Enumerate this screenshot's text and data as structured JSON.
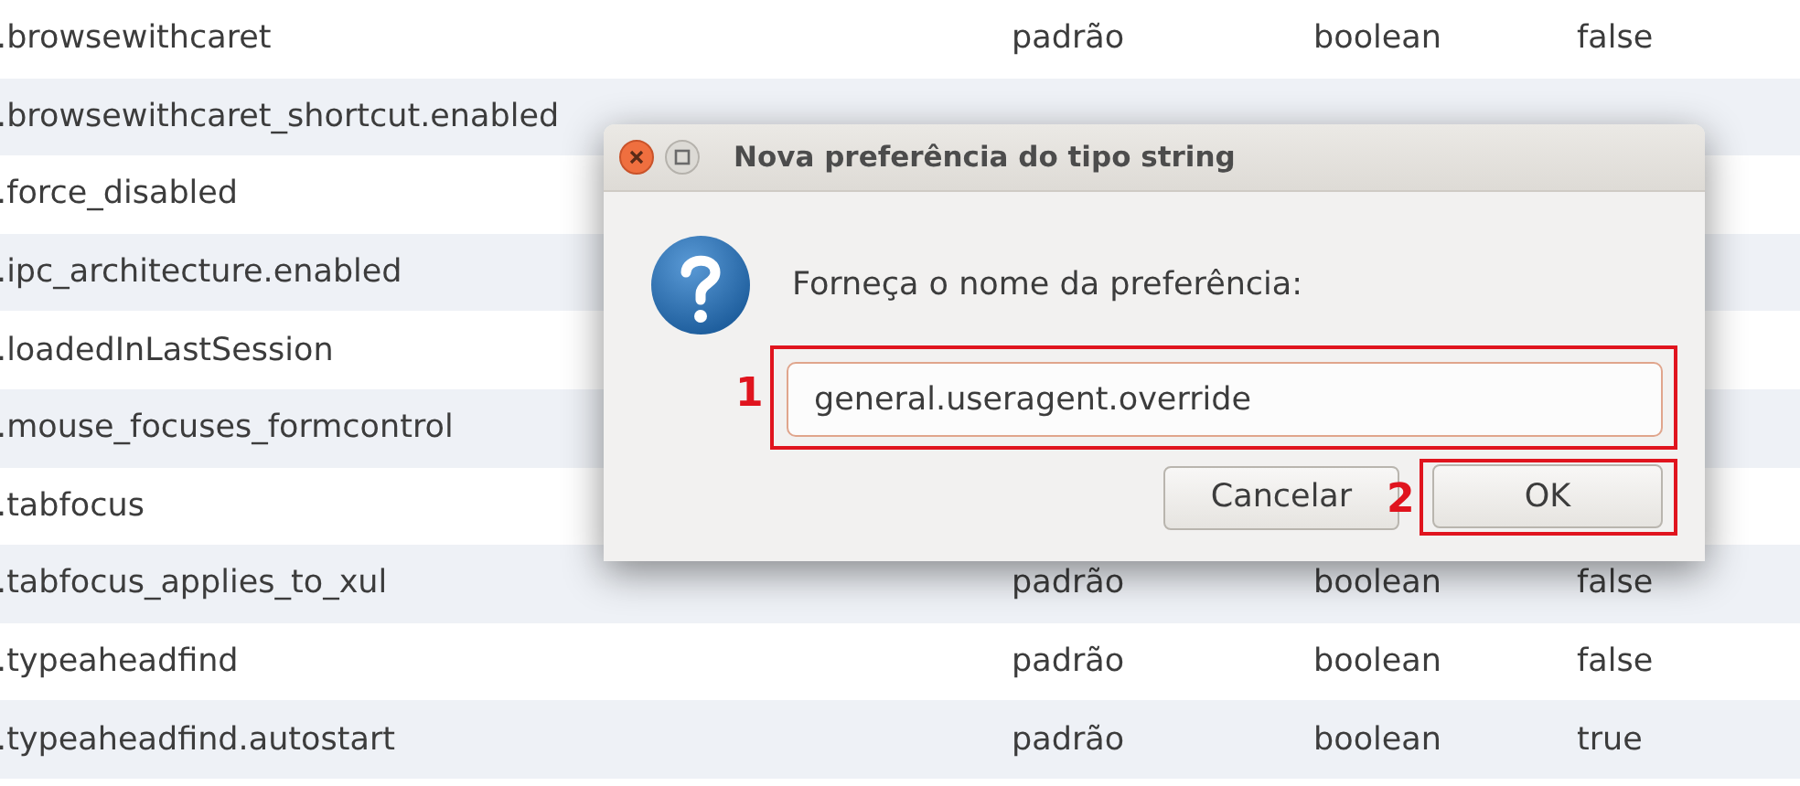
{
  "table": {
    "rows": [
      {
        "name": ".browsewithcaret",
        "status": "padrão",
        "type": "boolean",
        "value": "false"
      },
      {
        "name": ".browsewithcaret_shortcut.enabled"
      },
      {
        "name": ".force_disabled"
      },
      {
        "name": ".ipc_architecture.enabled"
      },
      {
        "name": ".loadedInLastSession"
      },
      {
        "name": ".mouse_focuses_formcontrol"
      },
      {
        "name": ".tabfocus"
      },
      {
        "name": ".tabfocus_applies_to_xul",
        "status": "padrão",
        "type": "boolean",
        "value": "false"
      },
      {
        "name": ".typeaheadfind",
        "status": "padrão",
        "type": "boolean",
        "value": "false"
      },
      {
        "name": ".typeaheadfind.autostart",
        "status": "padrão",
        "type": "boolean",
        "value": "true"
      }
    ]
  },
  "dialog": {
    "title": "Nova preferência do tipo string",
    "prompt": "Forneça o nome da preferência:",
    "field": {
      "value": "general.useragent.override",
      "step": "1"
    },
    "buttons": [
      {
        "label": "Cancelar",
        "kind": "cancel"
      },
      {
        "label": "OK",
        "kind": "ok",
        "step": "2"
      }
    ]
  }
}
